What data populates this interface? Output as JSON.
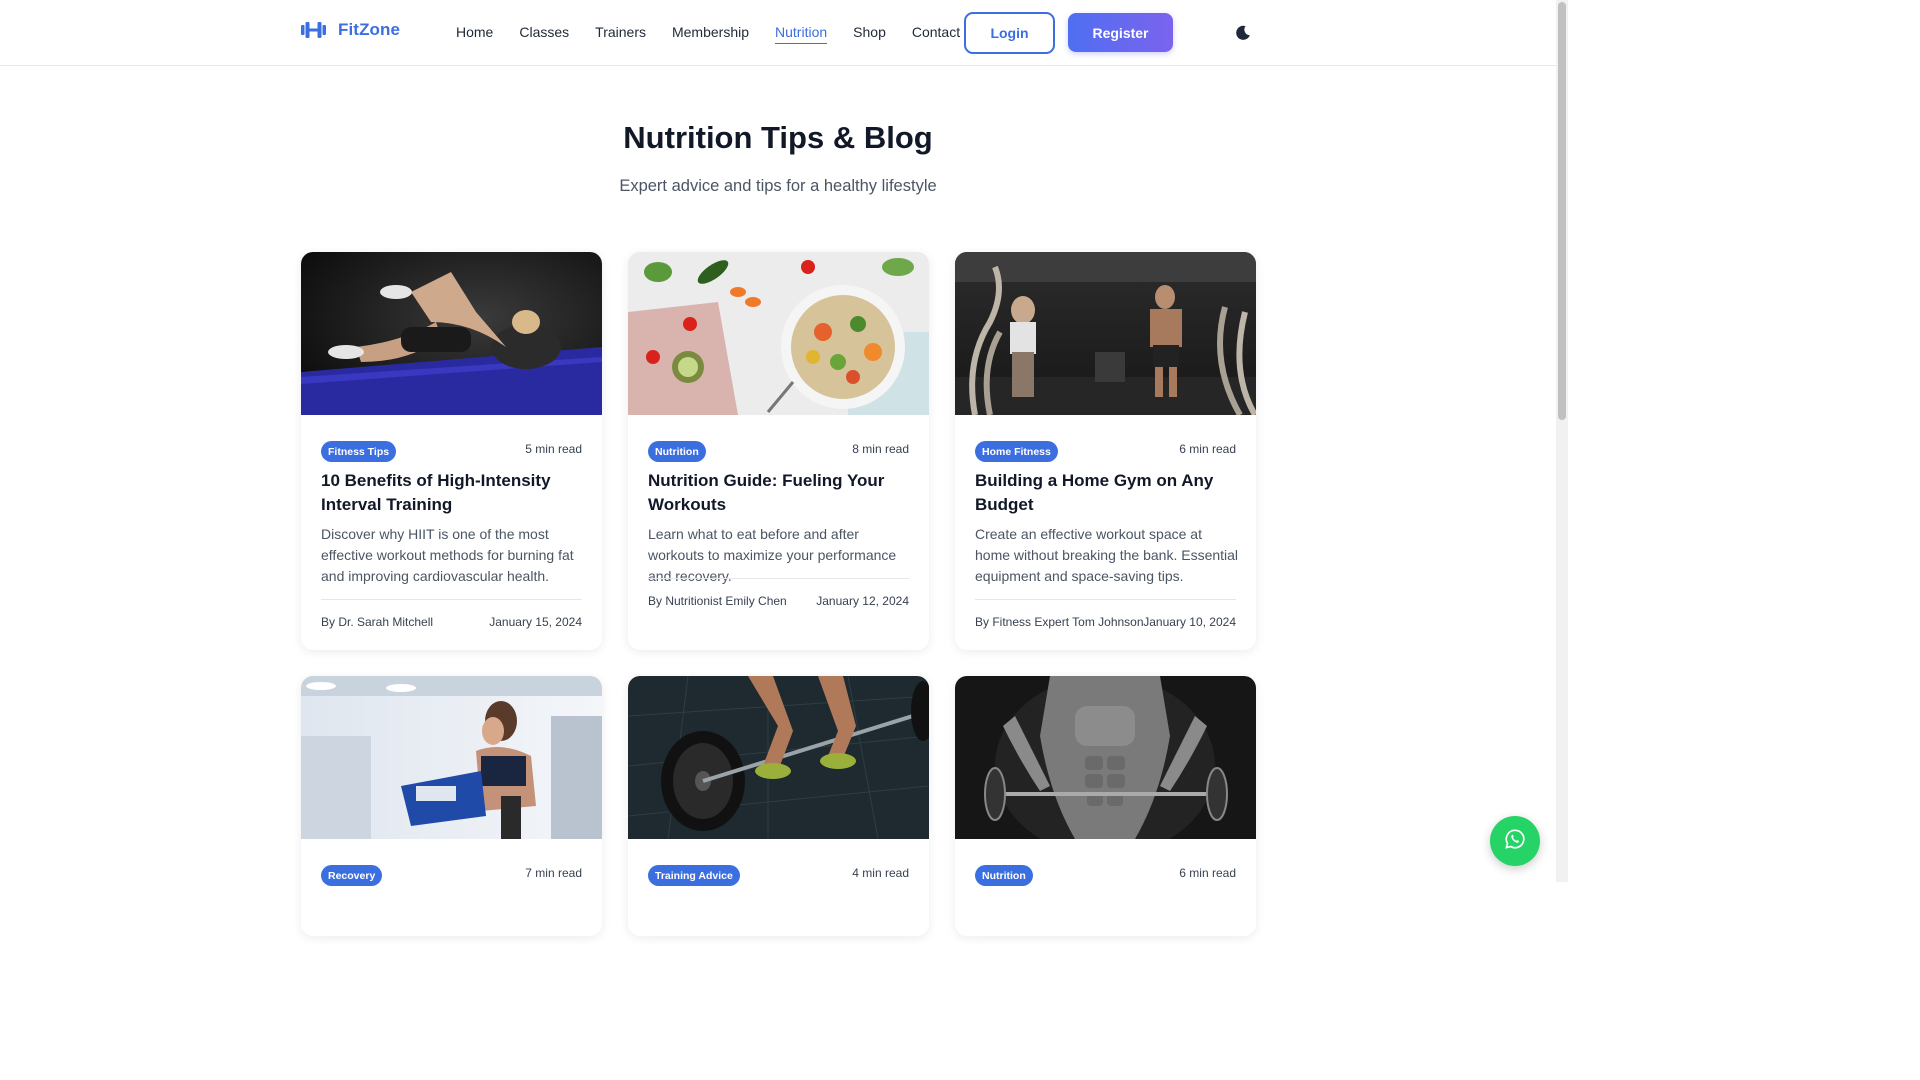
{
  "brand": {
    "name": "FitZone",
    "accent": "#3b6fe0"
  },
  "nav": {
    "items": [
      {
        "label": "Home",
        "active": false
      },
      {
        "label": "Classes",
        "active": false
      },
      {
        "label": "Trainers",
        "active": false
      },
      {
        "label": "Membership",
        "active": false
      },
      {
        "label": "Nutrition",
        "active": true
      },
      {
        "label": "Shop",
        "active": false
      },
      {
        "label": "Contact",
        "active": false
      }
    ],
    "login": "Login",
    "register": "Register",
    "theme_icon": "moon-icon"
  },
  "hero": {
    "title": "Nutrition Tips & Blog",
    "subtitle": "Expert advice and tips for a healthy lifestyle"
  },
  "posts": [
    {
      "category": "Fitness Tips",
      "read_time": "5 min read",
      "title": "10 Benefits of High-Intensity Interval Training",
      "excerpt": "Discover why HIIT is one of the most effective workout methods for burning fat and improving cardiovascular health.",
      "author": "By Dr. Sarah Mitchell",
      "date": "January 15, 2024",
      "image": "woman-doing-crunches-photo"
    },
    {
      "category": "Nutrition",
      "read_time": "8 min read",
      "title": "Nutrition Guide: Fueling Your Workouts",
      "excerpt": "Learn what to eat before and after workouts to maximize your performance and recovery.",
      "author": "By Nutritionist Emily Chen",
      "date": "January 12, 2024",
      "image": "healthy-food-bowl-photo"
    },
    {
      "category": "Home Fitness",
      "read_time": "6 min read",
      "title": "Building a Home Gym on Any Budget",
      "excerpt": "Create an effective workout space at home without breaking the bank. Essential equipment and space-saving tips.",
      "author": "By Fitness Expert Tom Johnson",
      "date": "January 10, 2024",
      "image": "battle-ropes-photo"
    },
    {
      "category": "Recovery",
      "read_time": "7 min read",
      "image": "woman-on-exercise-bike-photo"
    },
    {
      "category": "Training Advice",
      "read_time": "4 min read",
      "image": "barbell-deadlift-photo"
    },
    {
      "category": "Nutrition",
      "read_time": "6 min read",
      "image": "bodybuilder-barbell-curl-photo"
    }
  ],
  "floating": {
    "icon": "whatsapp-icon"
  }
}
